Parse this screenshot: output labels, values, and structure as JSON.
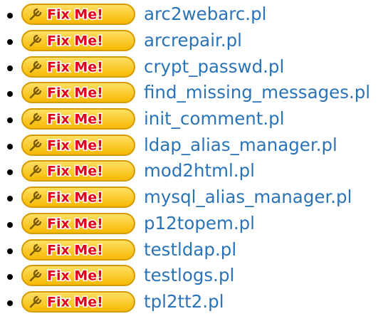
{
  "badge": {
    "label": "Fix Me!",
    "icon": "wrench-icon",
    "colors": {
      "fill_top": "#ffe066",
      "fill_bottom": "#f6b800",
      "border": "#d49a00",
      "text": "#e0001b",
      "text_outline": "#ffffff"
    }
  },
  "link_color": "#2b73b7",
  "items": [
    {
      "label": "arc2webarc.pl"
    },
    {
      "label": "arcrepair.pl"
    },
    {
      "label": "crypt_passwd.pl"
    },
    {
      "label": "find_missing_messages.pl"
    },
    {
      "label": "init_comment.pl"
    },
    {
      "label": "ldap_alias_manager.pl"
    },
    {
      "label": "mod2html.pl"
    },
    {
      "label": "mysql_alias_manager.pl"
    },
    {
      "label": "p12topem.pl"
    },
    {
      "label": "testldap.pl"
    },
    {
      "label": "testlogs.pl"
    },
    {
      "label": "tpl2tt2.pl"
    }
  ]
}
